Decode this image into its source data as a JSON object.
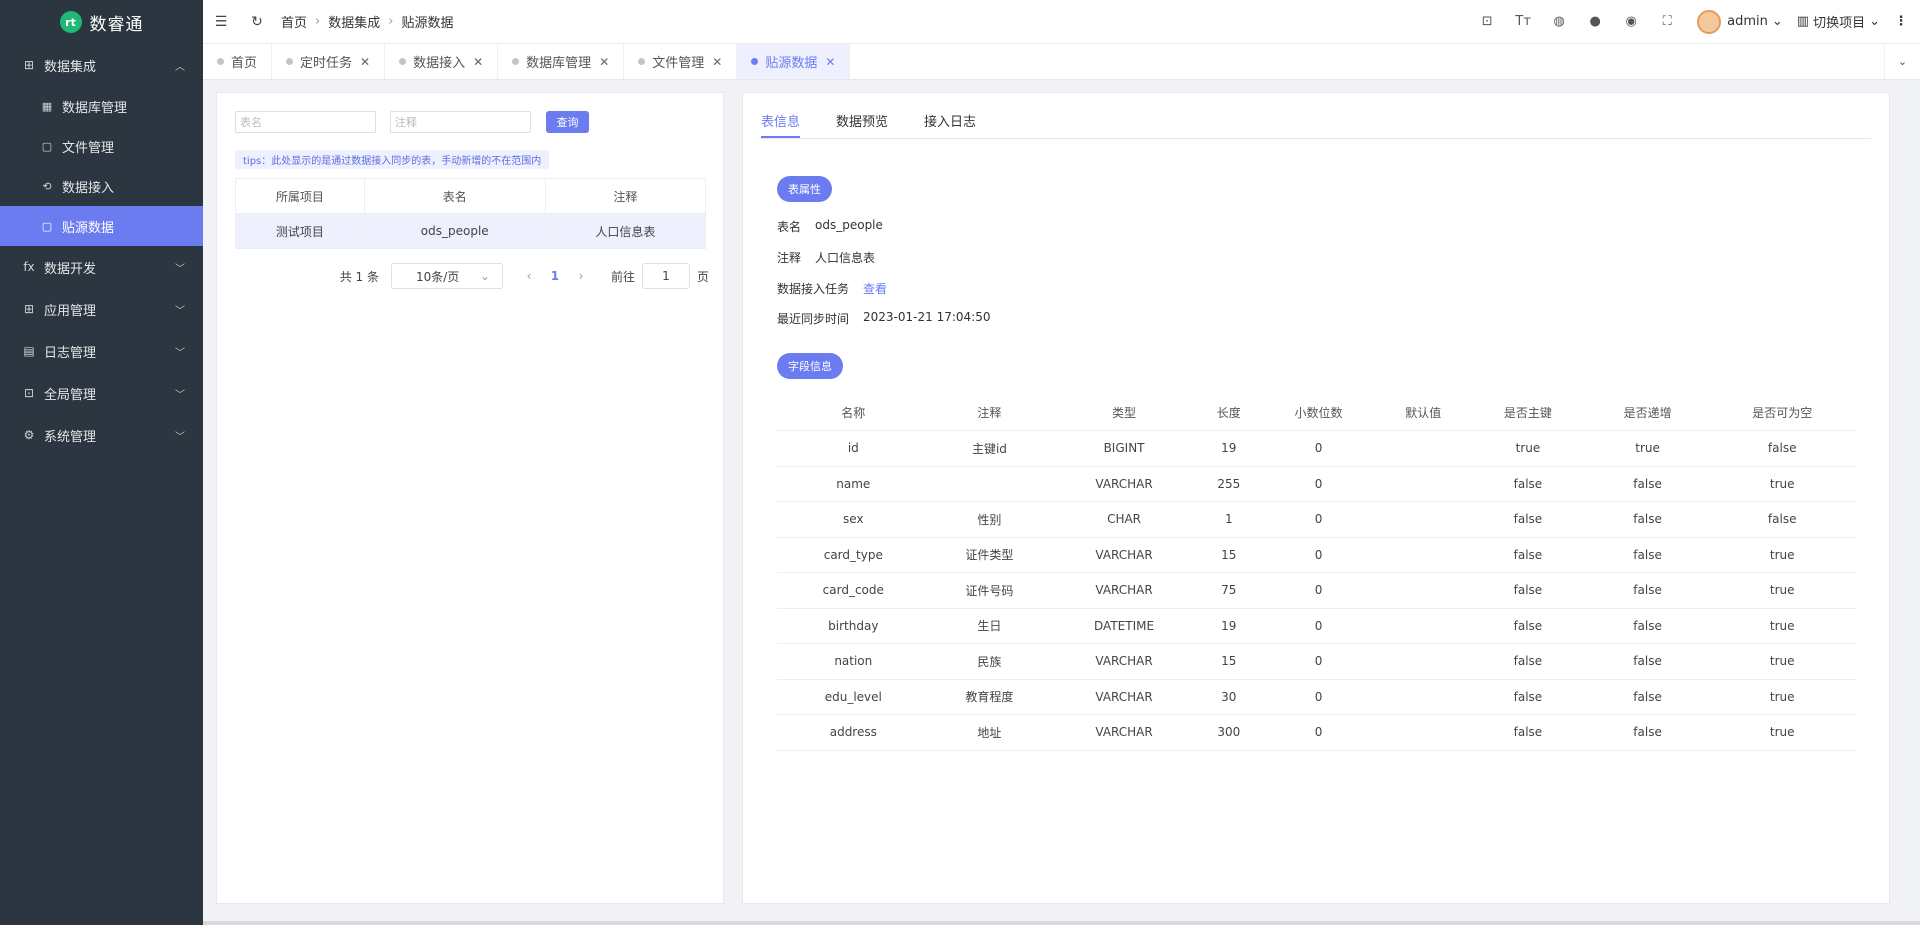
{
  "app": {
    "name": "数睿通",
    "logo_mark": "rt"
  },
  "sidebar": {
    "groups": [
      {
        "label": "数据集成",
        "icon": "grid-icon",
        "glyph": "⊞",
        "expanded": true,
        "items": [
          {
            "label": "数据库管理",
            "icon": "database-icon",
            "glyph": "▦"
          },
          {
            "label": "文件管理",
            "icon": "file-icon",
            "glyph": "▢"
          },
          {
            "label": "数据接入",
            "icon": "plug-icon",
            "glyph": "⟲"
          },
          {
            "label": "贴源数据",
            "icon": "table-icon",
            "glyph": "▢",
            "active": true
          }
        ]
      },
      {
        "label": "数据开发",
        "icon": "fx-icon",
        "glyph": "fx"
      },
      {
        "label": "应用管理",
        "icon": "apps-icon",
        "glyph": "⊞"
      },
      {
        "label": "日志管理",
        "icon": "log-icon",
        "glyph": "▤"
      },
      {
        "label": "全局管理",
        "icon": "globe-settings-icon",
        "glyph": "⊡"
      },
      {
        "label": "系统管理",
        "icon": "gear-icon",
        "glyph": "⚙"
      }
    ]
  },
  "header": {
    "breadcrumb": [
      "首页",
      "数据集成",
      "贴源数据"
    ],
    "user": "admin",
    "project_switch": "切换项目"
  },
  "tabs": [
    {
      "label": "首页",
      "closable": false
    },
    {
      "label": "定时任务",
      "closable": true
    },
    {
      "label": "数据接入",
      "closable": true
    },
    {
      "label": "数据库管理",
      "closable": true
    },
    {
      "label": "文件管理",
      "closable": true
    },
    {
      "label": "贴源数据",
      "closable": true,
      "active": true
    }
  ],
  "left": {
    "search": {
      "name_placeholder": "表名",
      "note_placeholder": "注释",
      "query_label": "查询"
    },
    "tips": "tips：此处显示的是通过数据接入同步的表，手动新增的不在范围内",
    "columns": [
      "所属项目",
      "表名",
      "注释"
    ],
    "rows": [
      [
        "测试项目",
        "ods_people",
        "人口信息表"
      ]
    ],
    "pager": {
      "total": "共 1 条",
      "size": "10条/页",
      "current": "1",
      "goto_label": "前往",
      "goto_value": "1",
      "page_unit": "页"
    }
  },
  "right": {
    "tabs": [
      "表信息",
      "数据预览",
      "接入日志"
    ],
    "table_attr_label": "表属性",
    "props": {
      "name_key": "表名",
      "name_val": "ods_people",
      "note_key": "注释",
      "note_val": "人口信息表",
      "task_key": "数据接入任务",
      "task_link": "查看",
      "sync_key": "最近同步时间",
      "sync_val": "2023-01-21 17:04:50"
    },
    "field_info_label": "字段信息",
    "field_columns": [
      "名称",
      "注释",
      "类型",
      "长度",
      "小数位数",
      "默认值",
      "是否主键",
      "是否递增",
      "是否可为空"
    ],
    "fields": [
      [
        "id",
        "主键id",
        "BIGINT",
        "19",
        "0",
        "",
        "true",
        "true",
        "false"
      ],
      [
        "name",
        "",
        "VARCHAR",
        "255",
        "0",
        "",
        "false",
        "false",
        "true"
      ],
      [
        "sex",
        "性别",
        "CHAR",
        "1",
        "0",
        "",
        "false",
        "false",
        "false"
      ],
      [
        "card_type",
        "证件类型",
        "VARCHAR",
        "15",
        "0",
        "",
        "false",
        "false",
        "true"
      ],
      [
        "card_code",
        "证件号码",
        "VARCHAR",
        "75",
        "0",
        "",
        "false",
        "false",
        "true"
      ],
      [
        "birthday",
        "生日",
        "DATETIME",
        "19",
        "0",
        "",
        "false",
        "false",
        "true"
      ],
      [
        "nation",
        "民族",
        "VARCHAR",
        "15",
        "0",
        "",
        "false",
        "false",
        "true"
      ],
      [
        "edu_level",
        "教育程度",
        "VARCHAR",
        "30",
        "0",
        "",
        "false",
        "false",
        "true"
      ],
      [
        "address",
        "地址",
        "VARCHAR",
        "300",
        "0",
        "",
        "false",
        "false",
        "true"
      ]
    ]
  },
  "colors": {
    "accent": "#6b7cf0",
    "sidebar_bg": "#2b3640",
    "logo_green": "#1fb877"
  }
}
